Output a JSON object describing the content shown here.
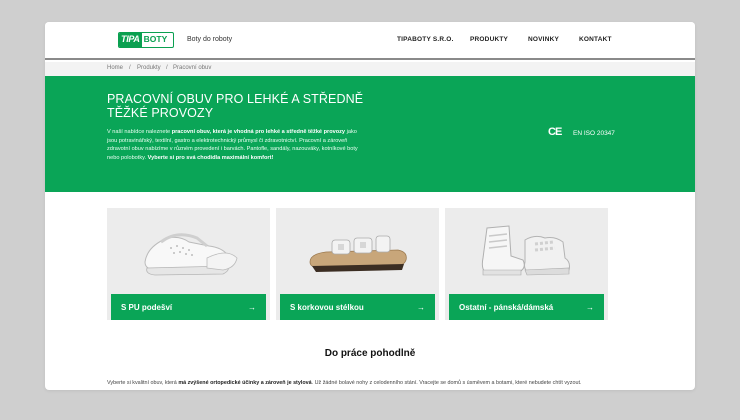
{
  "brand": {
    "logo_left": "TIPA",
    "logo_right": "BOTY",
    "tagline": "Boty do roboty",
    "accent": "#0aa557"
  },
  "nav": {
    "items": [
      "TIPABOTY S.R.O.",
      "PRODUKTY",
      "NOVINKY",
      "KONTAKT"
    ]
  },
  "breadcrumb": [
    "Home",
    "/",
    "Produkty",
    "/",
    "Pracovní obuv"
  ],
  "hero": {
    "title": "PRACOVNÍ OBUV PRO LEHKÉ A STŘEDNĚ TĚŽKÉ PROVOZY",
    "text_1": "V naší nabídce naleznete ",
    "text_bold_1": "pracovní obuv, která je vhodná pro lehké a středně těžké provozy",
    "text_2": " jako jsou potravinářský, textilní, gastro a elektrotechnický průmysl či zdravotnictví. Pracovní a zároveň zdravotní obuv nabízíme v různém provedení i barvách. Pantofle, sandály, nazouváky, kotníkové boty nebo polobotky. ",
    "text_bold_2": "Vyberte si pro svá chodidla maximální komfort!",
    "ce": "CE",
    "norm": "EN ISO 20347"
  },
  "cards": [
    {
      "label": "S PU podešví",
      "arrow": "→"
    },
    {
      "label": "S korkovou stélkou",
      "arrow": "→"
    },
    {
      "label": "Ostatní - pánská/dámská",
      "arrow": "→"
    }
  ],
  "section": {
    "title": "Do práce pohodlně",
    "text_1": "Vyberte si kvalitní obuv, která ",
    "text_bold": "má zvýšené ortopedické účinky a zároveň je stylová",
    "text_2": ". Už žádné bolavé nohy z celodenního stání. Vracejte se domů s úsměvem a botami, které nebudete chtít vyzout."
  }
}
